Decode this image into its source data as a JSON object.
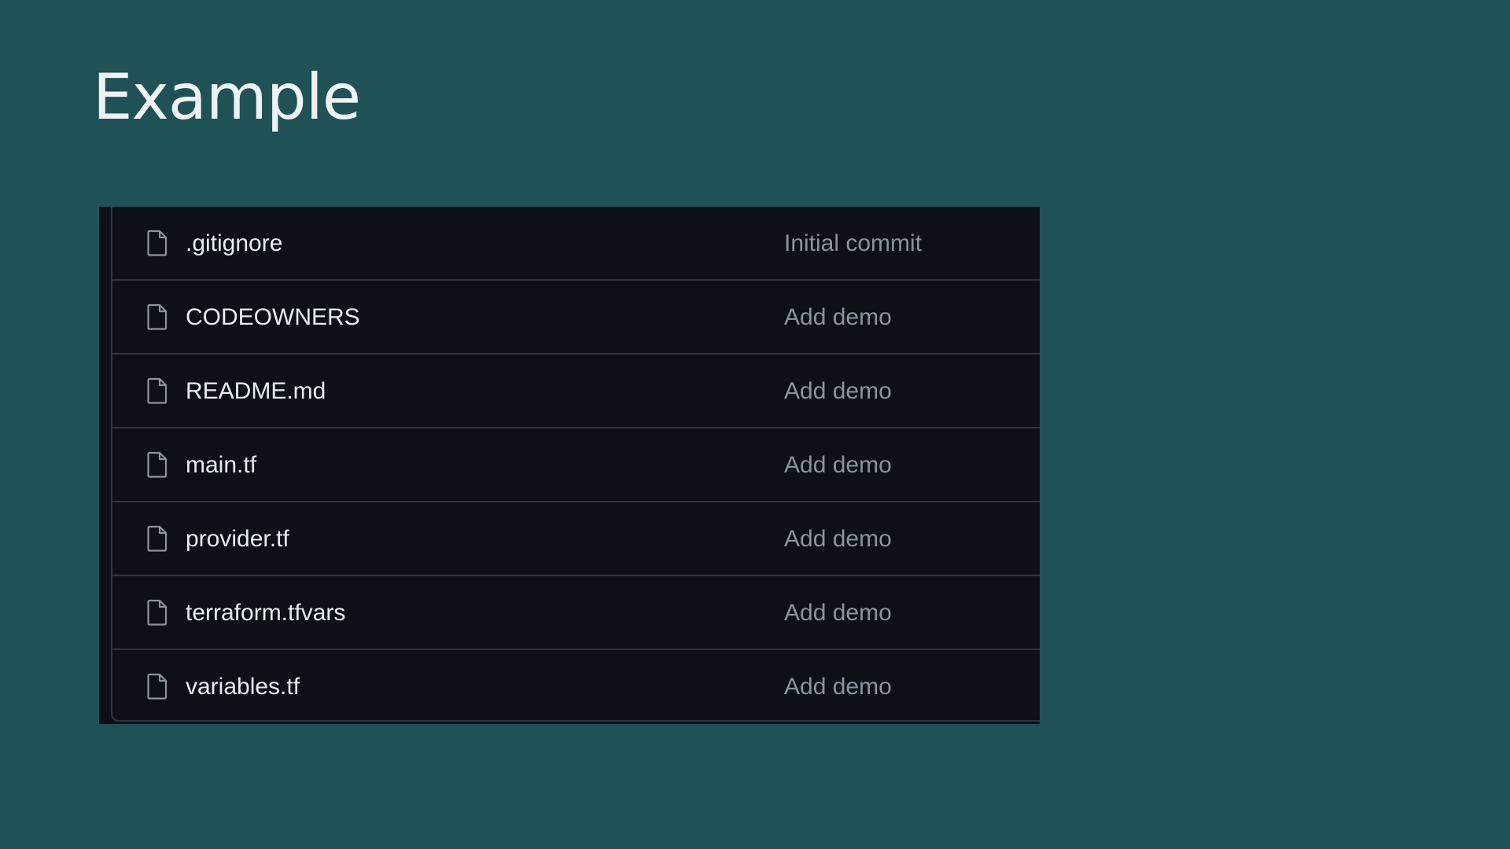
{
  "slide": {
    "title": "Example"
  },
  "file_list": {
    "items": [
      {
        "name": ".gitignore",
        "commit": "Initial commit",
        "icon": "file-icon"
      },
      {
        "name": "CODEOWNERS",
        "commit": "Add demo",
        "icon": "file-icon"
      },
      {
        "name": "README.md",
        "commit": "Add demo",
        "icon": "file-icon"
      },
      {
        "name": "main.tf",
        "commit": "Add demo",
        "icon": "file-icon"
      },
      {
        "name": "provider.tf",
        "commit": "Add demo",
        "icon": "file-icon"
      },
      {
        "name": "terraform.tfvars",
        "commit": "Add demo",
        "icon": "file-icon"
      },
      {
        "name": "variables.tf",
        "commit": "Add demo",
        "icon": "file-icon"
      }
    ]
  },
  "colors": {
    "slide_background": "#1f5157",
    "panel_background": "#0d1117",
    "border": "#30363d",
    "file_name_text": "#e6edf3",
    "commit_text": "#8b949e",
    "title_text": "#eef2f2"
  }
}
